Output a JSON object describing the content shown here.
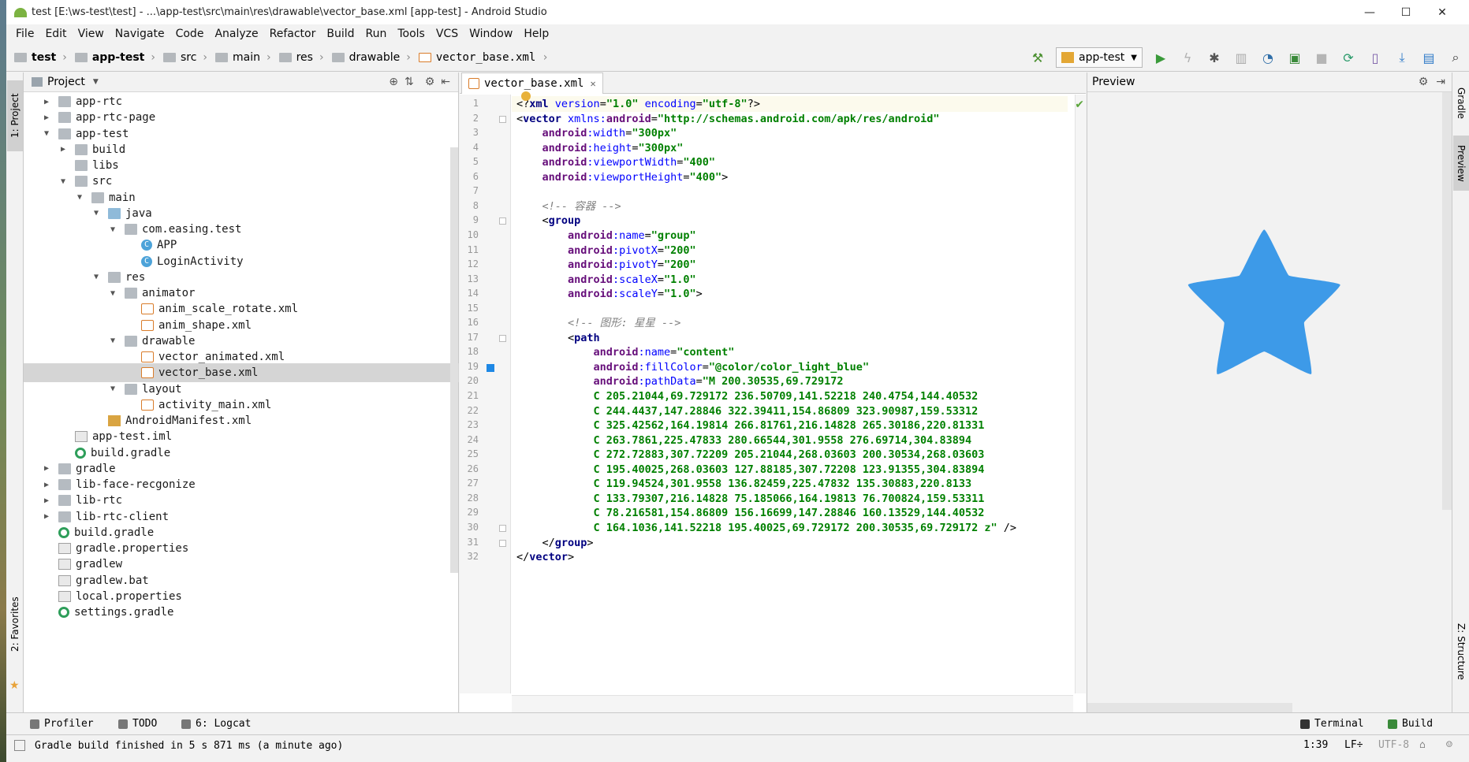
{
  "window": {
    "title": "test [E:\\ws-test\\test] - ...\\app-test\\src\\main\\res\\drawable\\vector_base.xml [app-test] - Android Studio",
    "minimize": "—",
    "maximize": "☐",
    "close": "✕"
  },
  "menu": [
    "File",
    "Edit",
    "View",
    "Navigate",
    "Code",
    "Analyze",
    "Refactor",
    "Build",
    "Run",
    "Tools",
    "VCS",
    "Window",
    "Help"
  ],
  "breadcrumbs": [
    "test",
    "app-test",
    "src",
    "main",
    "res",
    "drawable",
    "vector_base.xml"
  ],
  "toolbar": {
    "run_config": "app-test",
    "buttons": [
      "hammer-icon",
      "run-icon",
      "apply-changes-icon",
      "debug-icon",
      "coverage-icon",
      "profile-icon",
      "attach-debugger-icon",
      "stop-icon",
      "sync-icon",
      "avd-manager-icon",
      "sdk-manager-icon",
      "project-structure-icon",
      "search-icon"
    ]
  },
  "left_strip": {
    "project_tab": "1: Project",
    "favorites_tab": "2: Favorites"
  },
  "project_panel": {
    "title": "Project",
    "tree": [
      {
        "label": "app-rtc",
        "depth": 0,
        "expand": "collapsed",
        "icon": "folder"
      },
      {
        "label": "app-rtc-page",
        "depth": 0,
        "expand": "collapsed",
        "icon": "folder"
      },
      {
        "label": "app-test",
        "depth": 0,
        "expand": "expanded",
        "icon": "folder"
      },
      {
        "label": "build",
        "depth": 1,
        "expand": "collapsed",
        "icon": "folder"
      },
      {
        "label": "libs",
        "depth": 1,
        "expand": "none",
        "icon": "folder"
      },
      {
        "label": "src",
        "depth": 1,
        "expand": "expanded",
        "icon": "folder"
      },
      {
        "label": "main",
        "depth": 2,
        "expand": "expanded",
        "icon": "folder"
      },
      {
        "label": "java",
        "depth": 3,
        "expand": "expanded",
        "icon": "src"
      },
      {
        "label": "com.easing.test",
        "depth": 4,
        "expand": "expanded",
        "icon": "folder"
      },
      {
        "label": "APP",
        "depth": 5,
        "expand": "none",
        "icon": "class"
      },
      {
        "label": "LoginActivity",
        "depth": 5,
        "expand": "none",
        "icon": "class"
      },
      {
        "label": "res",
        "depth": 3,
        "expand": "expanded",
        "icon": "res"
      },
      {
        "label": "animator",
        "depth": 4,
        "expand": "expanded",
        "icon": "folder"
      },
      {
        "label": "anim_scale_rotate.xml",
        "depth": 5,
        "expand": "none",
        "icon": "xml"
      },
      {
        "label": "anim_shape.xml",
        "depth": 5,
        "expand": "none",
        "icon": "xml"
      },
      {
        "label": "drawable",
        "depth": 4,
        "expand": "expanded",
        "icon": "folder"
      },
      {
        "label": "vector_animated.xml",
        "depth": 5,
        "expand": "none",
        "icon": "xml"
      },
      {
        "label": "vector_base.xml",
        "depth": 5,
        "expand": "none",
        "icon": "xml",
        "selected": true
      },
      {
        "label": "layout",
        "depth": 4,
        "expand": "expanded",
        "icon": "folder"
      },
      {
        "label": "activity_main.xml",
        "depth": 5,
        "expand": "none",
        "icon": "xml"
      },
      {
        "label": "AndroidManifest.xml",
        "depth": 3,
        "expand": "none",
        "icon": "manifest"
      },
      {
        "label": "app-test.iml",
        "depth": 1,
        "expand": "none",
        "icon": "file"
      },
      {
        "label": "build.gradle",
        "depth": 1,
        "expand": "none",
        "icon": "gradle"
      },
      {
        "label": "gradle",
        "depth": 0,
        "expand": "collapsed",
        "icon": "folder"
      },
      {
        "label": "lib-face-recgonize",
        "depth": 0,
        "expand": "collapsed",
        "icon": "folder"
      },
      {
        "label": "lib-rtc",
        "depth": 0,
        "expand": "collapsed",
        "icon": "folder"
      },
      {
        "label": "lib-rtc-client",
        "depth": 0,
        "expand": "collapsed",
        "icon": "folder"
      },
      {
        "label": "build.gradle",
        "depth": 0,
        "expand": "none",
        "icon": "gradle"
      },
      {
        "label": "gradle.properties",
        "depth": 0,
        "expand": "none",
        "icon": "file"
      },
      {
        "label": "gradlew",
        "depth": 0,
        "expand": "none",
        "icon": "file"
      },
      {
        "label": "gradlew.bat",
        "depth": 0,
        "expand": "none",
        "icon": "file"
      },
      {
        "label": "local.properties",
        "depth": 0,
        "expand": "none",
        "icon": "file"
      },
      {
        "label": "settings.gradle",
        "depth": 0,
        "expand": "none",
        "icon": "gradle"
      }
    ]
  },
  "editor": {
    "tab": "vector_base.xml",
    "lines": [
      [
        [
          "pun",
          "<?"
        ],
        [
          "tag",
          "xml "
        ],
        [
          "attr",
          "version"
        ],
        [
          "pun",
          "="
        ],
        [
          "val",
          "\"1.0\" "
        ],
        [
          "attr",
          "encoding"
        ],
        [
          "pun",
          "="
        ],
        [
          "val",
          "\"utf-8\""
        ],
        [
          "pun",
          "?>"
        ]
      ],
      [
        [
          "pun",
          "<"
        ],
        [
          "tag",
          "vector "
        ],
        [
          "attr",
          "xmlns:"
        ],
        [
          "ns",
          "android"
        ],
        [
          "pun",
          "="
        ],
        [
          "val",
          "\"http://schemas.android.com/apk/res/android\""
        ]
      ],
      [
        [
          "pun",
          "    "
        ],
        [
          "ns",
          "android"
        ],
        [
          "attr",
          ":width"
        ],
        [
          "pun",
          "="
        ],
        [
          "val",
          "\"300px\""
        ]
      ],
      [
        [
          "pun",
          "    "
        ],
        [
          "ns",
          "android"
        ],
        [
          "attr",
          ":height"
        ],
        [
          "pun",
          "="
        ],
        [
          "val",
          "\"300px\""
        ]
      ],
      [
        [
          "pun",
          "    "
        ],
        [
          "ns",
          "android"
        ],
        [
          "attr",
          ":viewportWidth"
        ],
        [
          "pun",
          "="
        ],
        [
          "val",
          "\"400\""
        ]
      ],
      [
        [
          "pun",
          "    "
        ],
        [
          "ns",
          "android"
        ],
        [
          "attr",
          ":viewportHeight"
        ],
        [
          "pun",
          "="
        ],
        [
          "val",
          "\"400\""
        ],
        [
          "pun",
          ">"
        ]
      ],
      [],
      [
        [
          "pun",
          "    "
        ],
        [
          "com",
          "<!-- 容器 -->"
        ]
      ],
      [
        [
          "pun",
          "    <"
        ],
        [
          "tag",
          "group"
        ]
      ],
      [
        [
          "pun",
          "        "
        ],
        [
          "ns",
          "android"
        ],
        [
          "attr",
          ":name"
        ],
        [
          "pun",
          "="
        ],
        [
          "val",
          "\"group\""
        ]
      ],
      [
        [
          "pun",
          "        "
        ],
        [
          "ns",
          "android"
        ],
        [
          "attr",
          ":pivotX"
        ],
        [
          "pun",
          "="
        ],
        [
          "val",
          "\"200\""
        ]
      ],
      [
        [
          "pun",
          "        "
        ],
        [
          "ns",
          "android"
        ],
        [
          "attr",
          ":pivotY"
        ],
        [
          "pun",
          "="
        ],
        [
          "val",
          "\"200\""
        ]
      ],
      [
        [
          "pun",
          "        "
        ],
        [
          "ns",
          "android"
        ],
        [
          "attr",
          ":scaleX"
        ],
        [
          "pun",
          "="
        ],
        [
          "val",
          "\"1.0\""
        ]
      ],
      [
        [
          "pun",
          "        "
        ],
        [
          "ns",
          "android"
        ],
        [
          "attr",
          ":scaleY"
        ],
        [
          "pun",
          "="
        ],
        [
          "val",
          "\"1.0\""
        ],
        [
          "pun",
          ">"
        ]
      ],
      [],
      [
        [
          "pun",
          "        "
        ],
        [
          "com",
          "<!-- 图形: 星星 -->"
        ]
      ],
      [
        [
          "pun",
          "        <"
        ],
        [
          "tag",
          "path"
        ]
      ],
      [
        [
          "pun",
          "            "
        ],
        [
          "ns",
          "android"
        ],
        [
          "attr",
          ":name"
        ],
        [
          "pun",
          "="
        ],
        [
          "val",
          "\"content\""
        ]
      ],
      [
        [
          "pun",
          "            "
        ],
        [
          "ns",
          "android"
        ],
        [
          "attr",
          ":fillColor"
        ],
        [
          "pun",
          "="
        ],
        [
          "val",
          "\"@color/color_light_blue\""
        ]
      ],
      [
        [
          "pun",
          "            "
        ],
        [
          "ns",
          "android"
        ],
        [
          "attr",
          ":pathData"
        ],
        [
          "pun",
          "="
        ],
        [
          "val",
          "\"M 200.30535,69.729172"
        ]
      ],
      [
        [
          "pun",
          "            "
        ],
        [
          "val",
          "C 205.21044,69.729172 236.50709,141.52218 240.4754,144.40532"
        ]
      ],
      [
        [
          "pun",
          "            "
        ],
        [
          "val",
          "C 244.4437,147.28846 322.39411,154.86809 323.90987,159.53312"
        ]
      ],
      [
        [
          "pun",
          "            "
        ],
        [
          "val",
          "C 325.42562,164.19814 266.81761,216.14828 265.30186,220.81331"
        ]
      ],
      [
        [
          "pun",
          "            "
        ],
        [
          "val",
          "C 263.7861,225.47833 280.66544,301.9558 276.69714,304.83894"
        ]
      ],
      [
        [
          "pun",
          "            "
        ],
        [
          "val",
          "C 272.72883,307.72209 205.21044,268.03603 200.30534,268.03603"
        ]
      ],
      [
        [
          "pun",
          "            "
        ],
        [
          "val",
          "C 195.40025,268.03603 127.88185,307.72208 123.91355,304.83894"
        ]
      ],
      [
        [
          "pun",
          "            "
        ],
        [
          "val",
          "C 119.94524,301.9558 136.82459,225.47832 135.30883,220.8133"
        ]
      ],
      [
        [
          "pun",
          "            "
        ],
        [
          "val",
          "C 133.79307,216.14828 75.185066,164.19813 76.700824,159.53311"
        ]
      ],
      [
        [
          "pun",
          "            "
        ],
        [
          "val",
          "C 78.216581,154.86809 156.16699,147.28846 160.13529,144.40532"
        ]
      ],
      [
        [
          "pun",
          "            "
        ],
        [
          "val",
          "C 164.1036,141.52218 195.40025,69.729172 200.30535,69.729172 z\""
        ],
        [
          "pun",
          " />"
        ]
      ],
      [
        [
          "pun",
          "    </"
        ],
        [
          "tag",
          "group"
        ],
        [
          "pun",
          ">"
        ]
      ],
      [
        [
          "pun",
          "</"
        ],
        [
          "tag",
          "vector"
        ],
        [
          "pun",
          ">"
        ]
      ]
    ]
  },
  "preview": {
    "title": "Preview",
    "shape_color": "#3d9ae8"
  },
  "right_strip": {
    "gradle_tab": "Gradle",
    "preview_tab": "Preview",
    "structure_tab": "Z: Structure"
  },
  "bottom_tabs": {
    "profiler": "Profiler",
    "todo": "TODO",
    "logcat": "6: Logcat",
    "terminal": "Terminal",
    "build": "Build"
  },
  "status": {
    "message": "Gradle build finished in 5 s 871 ms (a minute ago)",
    "position": "1:39",
    "line_sep": "LF÷",
    "encoding": "UTF-8"
  }
}
